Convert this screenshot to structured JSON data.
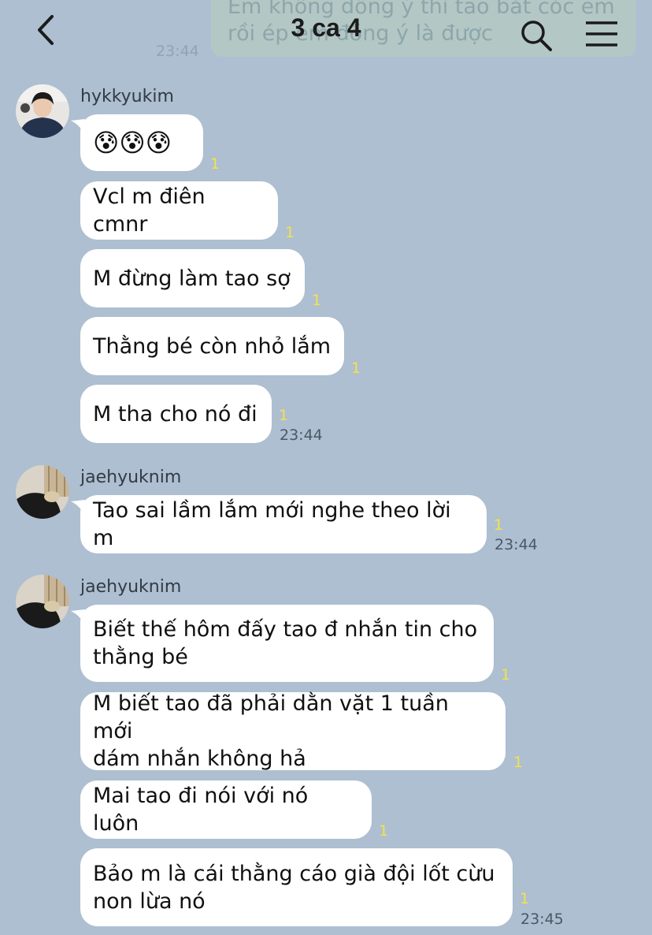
{
  "header": {
    "title": "3 ca 4",
    "back_icon": "chevron-left-icon",
    "search_icon": "search-icon",
    "menu_icon": "hamburger-menu-icon"
  },
  "previous_message": {
    "text": "Em không đồng ý thì tao bắt cóc em\nrồi ép em đồng ý là được",
    "time": "23:44"
  },
  "groups": [
    {
      "sender": "hykkyukim",
      "messages": [
        {
          "text": "😰😰😰",
          "unread": "1"
        },
        {
          "text": "Vcl m điên cmnr",
          "unread": "1"
        },
        {
          "text": "M đừng làm tao sợ",
          "unread": "1"
        },
        {
          "text": "Thằng bé còn nhỏ lắm",
          "unread": "1"
        },
        {
          "text": "M tha cho nó đi",
          "unread": "1",
          "time": "23:44"
        }
      ]
    },
    {
      "sender": "jaehyuknim",
      "messages": [
        {
          "text": "Tao sai lầm lắm mới nghe theo lời m",
          "unread": "1",
          "time": "23:44"
        }
      ]
    },
    {
      "sender": "jaehyuknim",
      "messages": [
        {
          "text": "Biết thế hôm đấy tao đ nhắn tin cho\nthằng bé",
          "unread": "1"
        },
        {
          "text": "M biết tao đã phải dằn vặt 1 tuần mới\ndám nhắn không hả",
          "unread": "1"
        },
        {
          "text": "Mai tao đi nói với nó luôn",
          "unread": "1"
        },
        {
          "text": "Bảo m là cái thằng cáo già đội lốt cừu\nnon lừa nó",
          "unread": "1",
          "time": "23:45"
        }
      ]
    }
  ]
}
